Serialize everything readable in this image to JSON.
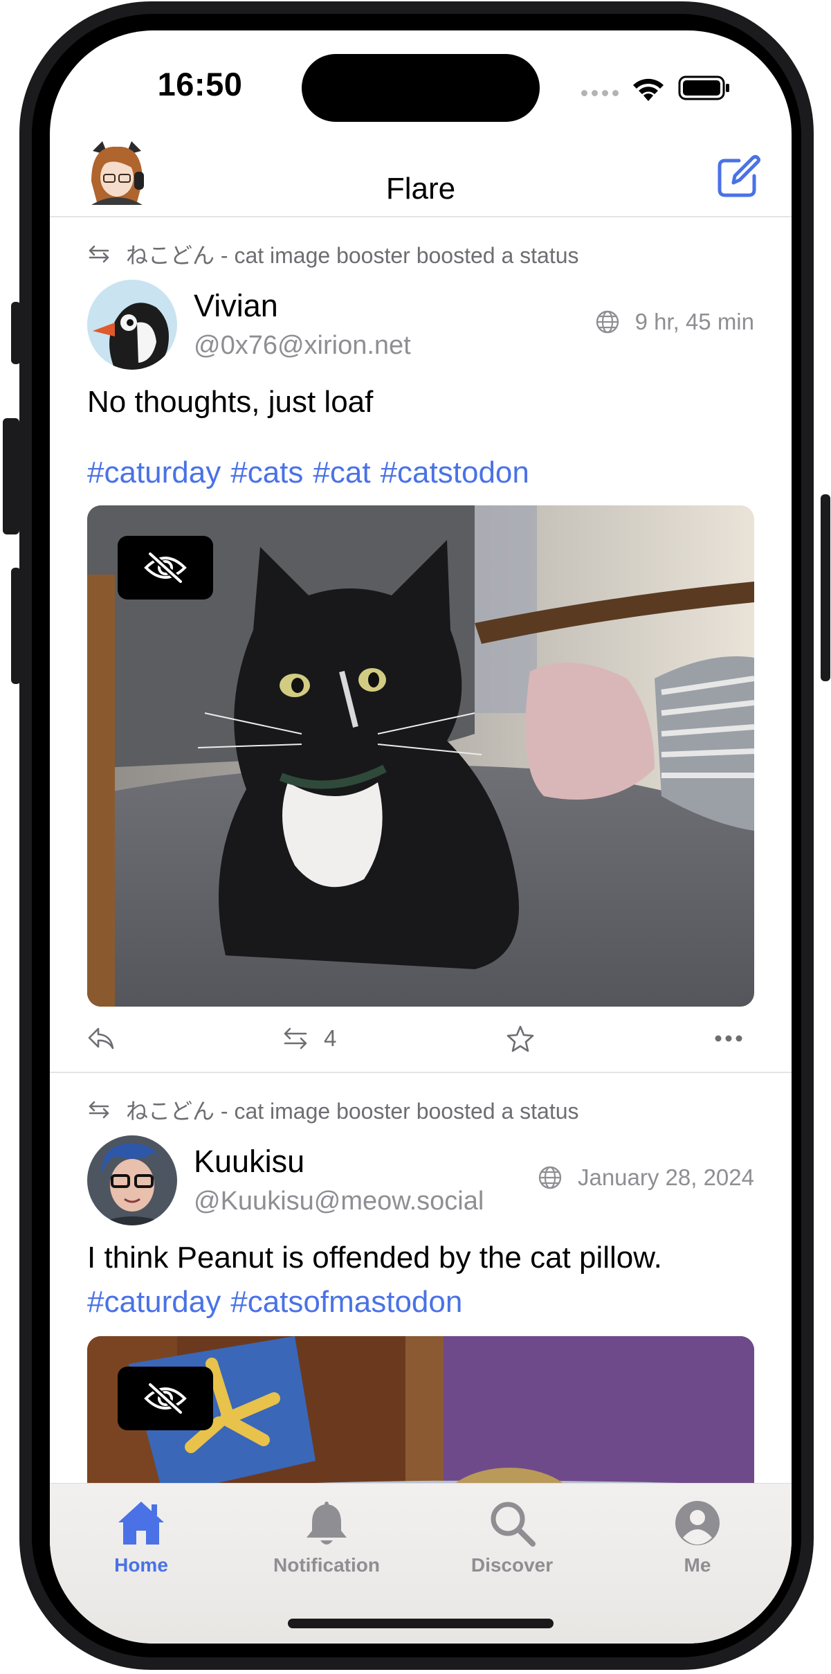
{
  "status_bar": {
    "time": "16:50"
  },
  "header": {
    "title": "Flare"
  },
  "posts": [
    {
      "boost_label": "ねこどん - cat image booster boosted a status",
      "author_name": "Vivian",
      "author_handle": "@0x76@xirion.net",
      "timestamp": "9 hr, 45 min",
      "text": "No thoughts, just loaf",
      "hashtags": [
        "#caturday",
        "#cats",
        "#cat",
        "#catstodon"
      ],
      "boost_count": "4"
    },
    {
      "boost_label": "ねこどん - cat image booster boosted a status",
      "author_name": "Kuukisu",
      "author_handle": "@Kuukisu@meow.social",
      "timestamp": "January 28, 2024",
      "text": "I think Peanut is offended by the cat pillow.",
      "hashtags": [
        "#caturday",
        "#catsofmastodon"
      ]
    }
  ],
  "tabs": [
    {
      "label": "Home",
      "icon": "house-icon",
      "active": true
    },
    {
      "label": "Notification",
      "icon": "bell-icon",
      "active": false
    },
    {
      "label": "Discover",
      "icon": "magnifier-icon",
      "active": false
    },
    {
      "label": "Me",
      "icon": "person-icon",
      "active": false
    }
  ],
  "colors": {
    "accent": "#4a72e6",
    "secondary_text": "#8e8e93",
    "link": "#4a72e6"
  }
}
